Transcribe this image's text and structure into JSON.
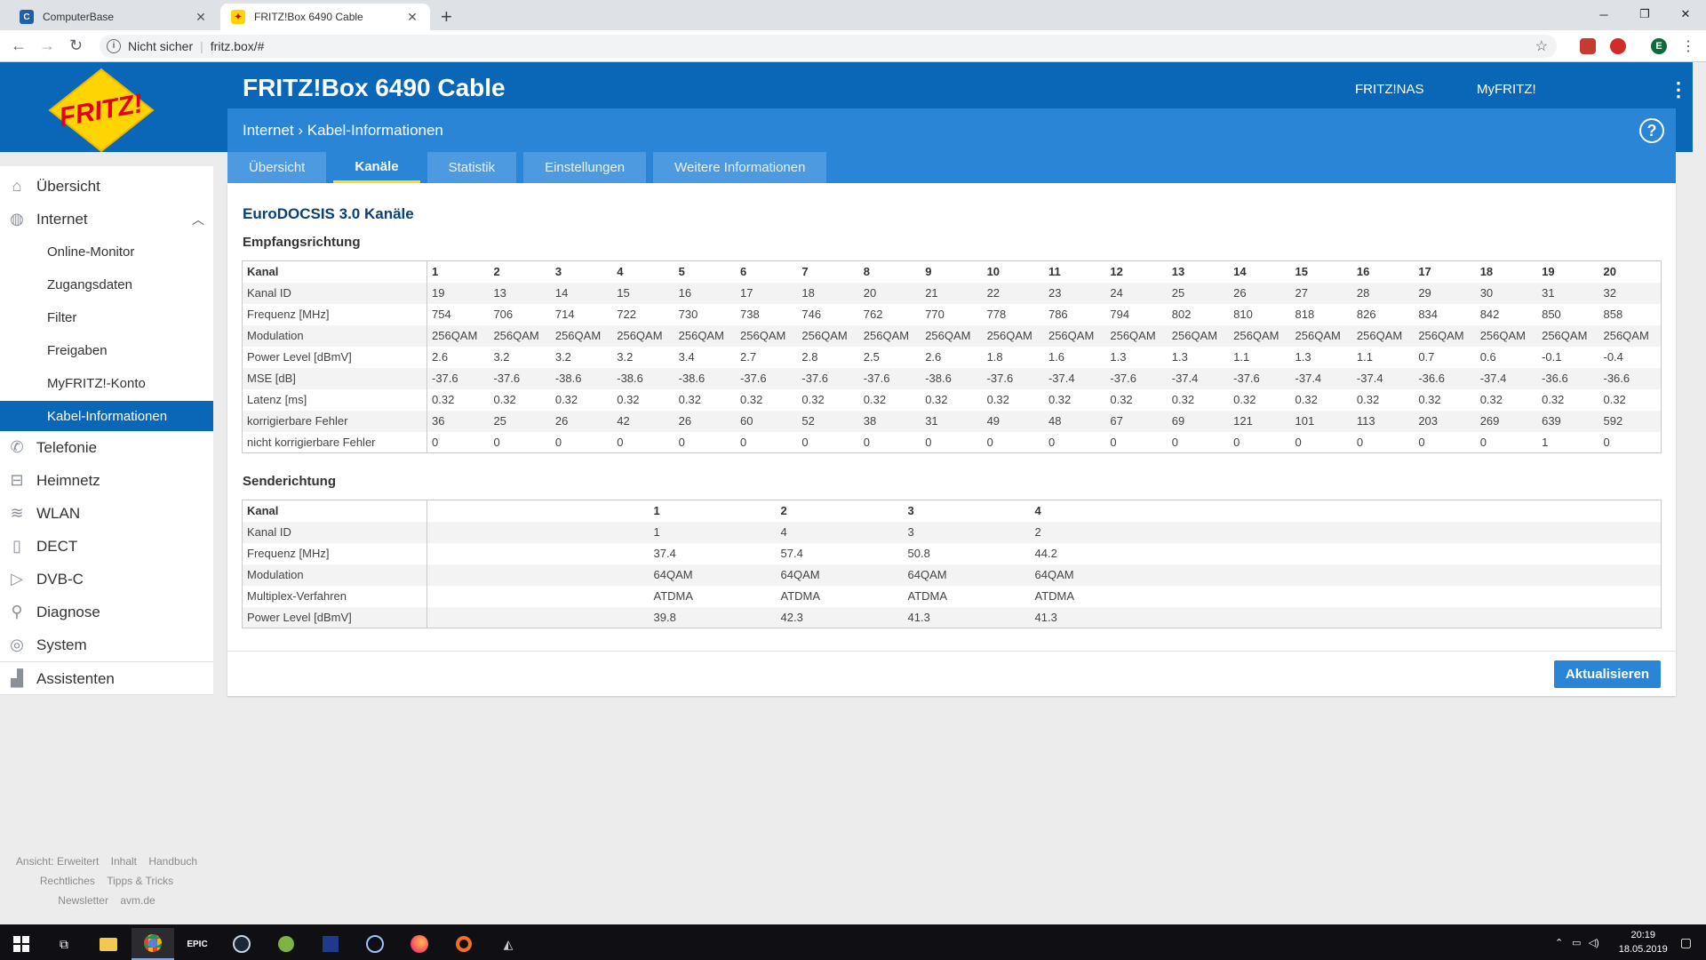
{
  "browser": {
    "tabs": [
      {
        "title": "ComputerBase",
        "active": false
      },
      {
        "title": "FRITZ!Box 6490 Cable",
        "active": true
      }
    ],
    "security_label": "Nicht sicher",
    "url": "fritz.box/#",
    "profile_initial": "E"
  },
  "header": {
    "logo_text": "FRITZ!",
    "title": "FRITZ!Box 6490 Cable",
    "links": [
      "FRITZ!NAS",
      "MyFRITZ!"
    ],
    "breadcrumb": [
      "Internet",
      "Kabel-Informationen"
    ]
  },
  "page_tabs": [
    {
      "label": "Übersicht",
      "active": false
    },
    {
      "label": "Kanäle",
      "active": true
    },
    {
      "label": "Statistik",
      "active": false
    },
    {
      "label": "Einstellungen",
      "active": false
    },
    {
      "label": "Weitere Informationen",
      "active": false
    }
  ],
  "sidebar": {
    "items": [
      {
        "label": "Übersicht",
        "icon": "home-icon"
      },
      {
        "label": "Internet",
        "icon": "globe-icon"
      },
      {
        "label": "Telefonie",
        "icon": "phone-icon"
      },
      {
        "label": "Heimnetz",
        "icon": "network-icon"
      },
      {
        "label": "WLAN",
        "icon": "wifi-icon"
      },
      {
        "label": "DECT",
        "icon": "dect-icon"
      },
      {
        "label": "DVB-C",
        "icon": "tv-icon"
      },
      {
        "label": "Diagnose",
        "icon": "diagnose-icon"
      },
      {
        "label": "System",
        "icon": "system-icon"
      },
      {
        "label": "Assistenten",
        "icon": "wizard-icon"
      }
    ],
    "internet_sub": [
      "Online-Monitor",
      "Zugangsdaten",
      "Filter",
      "Freigaben",
      "MyFRITZ!-Konto",
      "Kabel-Informationen"
    ],
    "active_sub": "Kabel-Informationen"
  },
  "footer_links": [
    [
      "Ansicht: Erweitert",
      "Inhalt",
      "Handbuch"
    ],
    [
      "Rechtliches",
      "Tipps & Tricks"
    ],
    [
      "Newsletter",
      "avm.de"
    ]
  ],
  "content": {
    "title": "EuroDOCSIS 3.0 Kanäle",
    "downstream": {
      "title": "Empfangsrichtung",
      "rows": [
        {
          "label": "Kanal",
          "values": [
            "1",
            "2",
            "3",
            "4",
            "5",
            "6",
            "7",
            "8",
            "9",
            "10",
            "11",
            "12",
            "13",
            "14",
            "15",
            "16",
            "17",
            "18",
            "19",
            "20"
          ]
        },
        {
          "label": "Kanal ID",
          "values": [
            "19",
            "13",
            "14",
            "15",
            "16",
            "17",
            "18",
            "20",
            "21",
            "22",
            "23",
            "24",
            "25",
            "26",
            "27",
            "28",
            "29",
            "30",
            "31",
            "32"
          ]
        },
        {
          "label": "Frequenz [MHz]",
          "values": [
            "754",
            "706",
            "714",
            "722",
            "730",
            "738",
            "746",
            "762",
            "770",
            "778",
            "786",
            "794",
            "802",
            "810",
            "818",
            "826",
            "834",
            "842",
            "850",
            "858"
          ]
        },
        {
          "label": "Modulation",
          "values": [
            "256QAM",
            "256QAM",
            "256QAM",
            "256QAM",
            "256QAM",
            "256QAM",
            "256QAM",
            "256QAM",
            "256QAM",
            "256QAM",
            "256QAM",
            "256QAM",
            "256QAM",
            "256QAM",
            "256QAM",
            "256QAM",
            "256QAM",
            "256QAM",
            "256QAM",
            "256QAM"
          ]
        },
        {
          "label": "Power Level [dBmV]",
          "values": [
            "2.6",
            "3.2",
            "3.2",
            "3.2",
            "3.4",
            "2.7",
            "2.8",
            "2.5",
            "2.6",
            "1.8",
            "1.6",
            "1.3",
            "1.3",
            "1.1",
            "1.3",
            "1.1",
            "0.7",
            "0.6",
            "-0.1",
            "-0.4"
          ]
        },
        {
          "label": "MSE [dB]",
          "values": [
            "-37.6",
            "-37.6",
            "-38.6",
            "-38.6",
            "-38.6",
            "-37.6",
            "-37.6",
            "-37.6",
            "-38.6",
            "-37.6",
            "-37.4",
            "-37.6",
            "-37.4",
            "-37.6",
            "-37.4",
            "-37.4",
            "-36.6",
            "-37.4",
            "-36.6",
            "-36.6"
          ]
        },
        {
          "label": "Latenz [ms]",
          "values": [
            "0.32",
            "0.32",
            "0.32",
            "0.32",
            "0.32",
            "0.32",
            "0.32",
            "0.32",
            "0.32",
            "0.32",
            "0.32",
            "0.32",
            "0.32",
            "0.32",
            "0.32",
            "0.32",
            "0.32",
            "0.32",
            "0.32",
            "0.32"
          ]
        },
        {
          "label": "korrigierbare Fehler",
          "values": [
            "36",
            "25",
            "26",
            "42",
            "26",
            "60",
            "52",
            "38",
            "31",
            "49",
            "48",
            "67",
            "69",
            "121",
            "101",
            "113",
            "203",
            "269",
            "639",
            "592"
          ]
        },
        {
          "label": "nicht korrigierbare Fehler",
          "values": [
            "0",
            "0",
            "0",
            "0",
            "0",
            "0",
            "0",
            "0",
            "0",
            "0",
            "0",
            "0",
            "0",
            "0",
            "0",
            "0",
            "0",
            "0",
            "1",
            "0"
          ]
        }
      ]
    },
    "upstream": {
      "title": "Senderichtung",
      "rows": [
        {
          "label": "Kanal",
          "values": [
            "1",
            "2",
            "3",
            "4"
          ]
        },
        {
          "label": "Kanal ID",
          "values": [
            "1",
            "4",
            "3",
            "2"
          ]
        },
        {
          "label": "Frequenz [MHz]",
          "values": [
            "37.4",
            "57.4",
            "50.8",
            "44.2"
          ]
        },
        {
          "label": "Modulation",
          "values": [
            "64QAM",
            "64QAM",
            "64QAM",
            "64QAM"
          ]
        },
        {
          "label": "Multiplex-Verfahren",
          "values": [
            "ATDMA",
            "ATDMA",
            "ATDMA",
            "ATDMA"
          ]
        },
        {
          "label": "Power Level [dBmV]",
          "values": [
            "39.8",
            "42.3",
            "41.3",
            "41.3"
          ]
        }
      ]
    },
    "refresh_button": "Aktualisieren"
  },
  "taskbar": {
    "time": "20:19",
    "date": "18.05.2019",
    "apps": [
      "start-icon",
      "task-view-icon",
      "explorer-icon",
      "chrome-icon",
      "epic-games-icon",
      "steam-icon",
      "app-icon",
      "app-icon",
      "app-icon",
      "firefox-icon",
      "origin-icon",
      "app-icon"
    ]
  },
  "colors": {
    "brand_blue": "#0a66b6",
    "sub_blue": "#2a85d6",
    "tab_underline": "#ffe200"
  }
}
